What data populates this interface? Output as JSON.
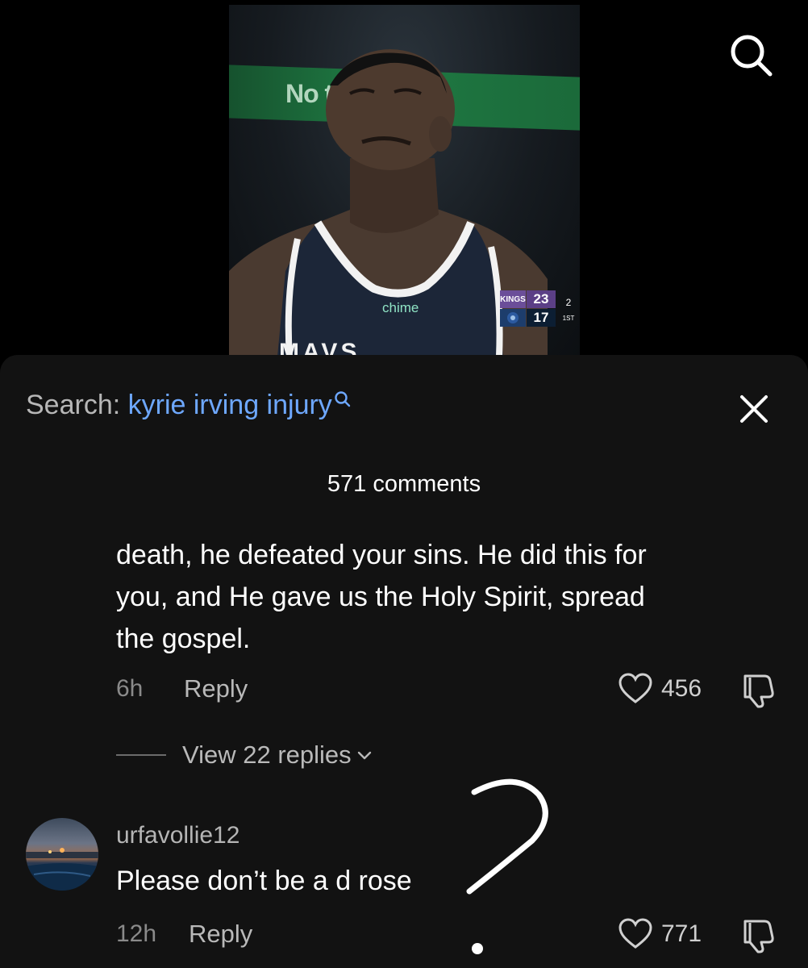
{
  "video": {
    "banner_text": "No      thly fees",
    "jersey_sponsor": "chime",
    "jersey_text": "MAVS",
    "scorebug": {
      "team1": "KINGS",
      "team1_score": "23",
      "team2_score": "17",
      "period_top": "2",
      "period_bottom": "1ST"
    }
  },
  "top_bar": {
    "search_icon": "search-icon"
  },
  "sheet": {
    "search_prefix": "Search: ",
    "search_term": "kyrie irving injury",
    "close_icon": "close-icon",
    "comments_count": "571 comments"
  },
  "comments": [
    {
      "text_lines": [
        "death, he defeated your sins. He did this for",
        "you, and He gave us the Holy Spirit, spread",
        "the gospel."
      ],
      "time": "6h",
      "reply_label": "Reply",
      "likes": "456",
      "view_replies": "View 22 replies"
    },
    {
      "username": "urfavollie12",
      "text": "Please don’t be a d rose",
      "time": "12h",
      "reply_label": "Reply",
      "likes": "771"
    }
  ],
  "colors": {
    "background": "#000000",
    "sheet": "#121212",
    "link_blue": "#6ea8ff",
    "muted_text": "#8a8a8a"
  }
}
